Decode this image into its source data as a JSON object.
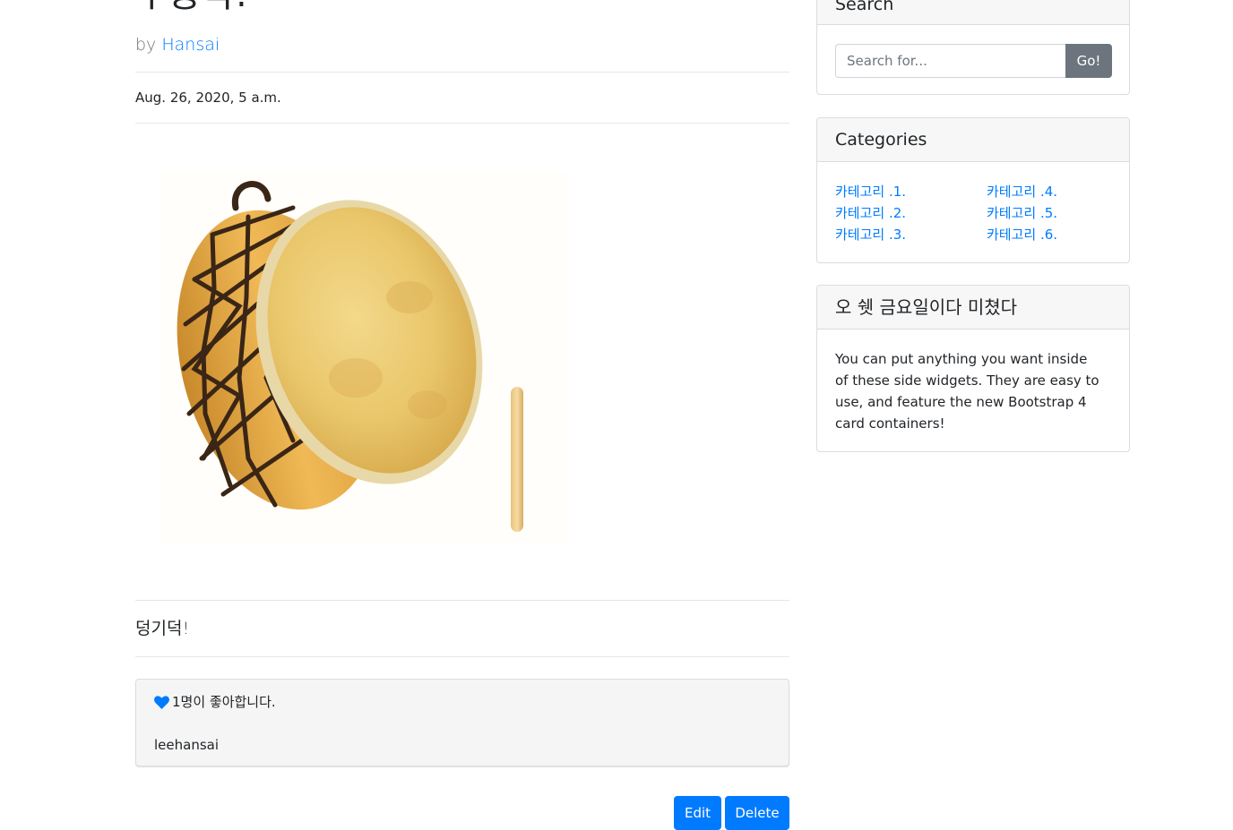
{
  "post": {
    "title": "두둥딱!",
    "by_prefix": "by ",
    "author": "Hansai",
    "date": "Aug. 26, 2020, 5 a.m.",
    "body": "덩기덕!"
  },
  "likes": {
    "text": "1명이 좋아합니다.",
    "users": [
      "leehansai"
    ],
    "icon": "heart-icon",
    "icon_color": "#007bff"
  },
  "actions": {
    "edit_label": "Edit",
    "delete_label": "Delete"
  },
  "sidebar": {
    "search": {
      "title": "Search",
      "placeholder": "Search for...",
      "button_label": "Go!"
    },
    "categories": {
      "title": "Categories",
      "items": [
        "카테고리 .1.",
        "카테고리 .2.",
        "카테고리 .3.",
        "카테고리 .4.",
        "카테고리 .5.",
        "카테고리 .6."
      ]
    },
    "widget": {
      "title": "오 쉣 금요일이다 미쳤다",
      "text": "You can put anything you want inside of these side widgets. They are easy to use, and feature the new Bootstrap 4 card containers!"
    }
  },
  "colors": {
    "accent": "#007bff",
    "secondary": "#6c757d"
  }
}
